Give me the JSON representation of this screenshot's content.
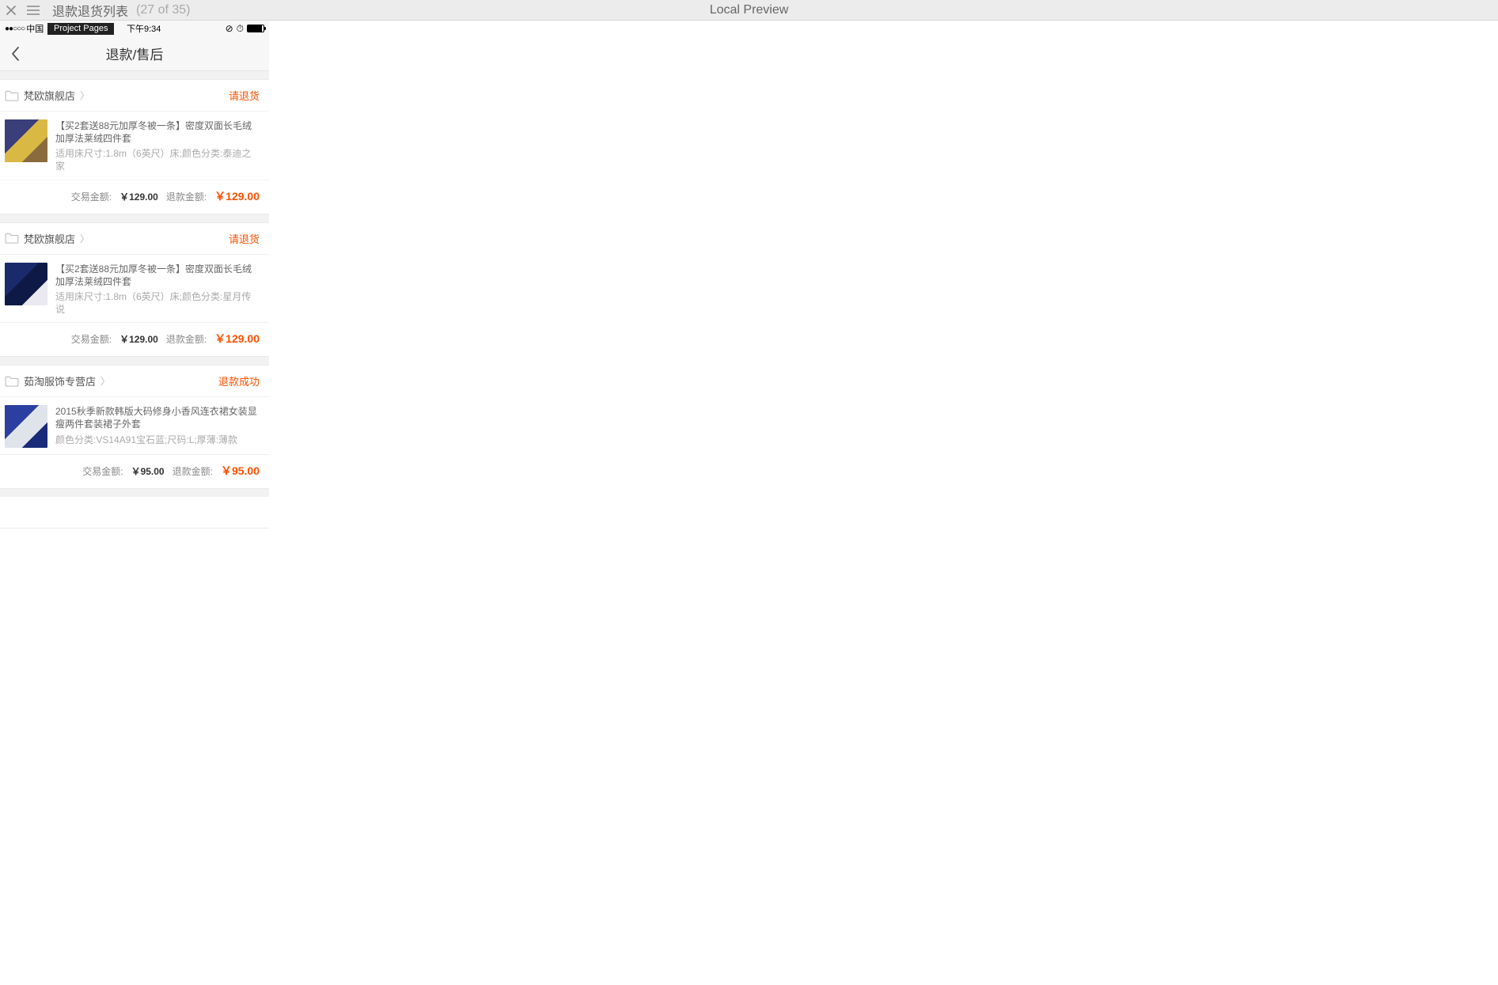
{
  "editor": {
    "title": "退款退货列表",
    "counter": "(27 of 35)",
    "preview": "Local Preview"
  },
  "statusbar": {
    "signal": "●●○○○",
    "carrier": "中国",
    "badge": "Project Pages",
    "time": "下午9:34"
  },
  "nav": {
    "title": "退款/售后"
  },
  "labels": {
    "transaction_amount": "交易金额:",
    "refund_amount": "退款金额:"
  },
  "orders": [
    {
      "store": "梵欧旗舰店",
      "status": "请退货",
      "title": "【买2套送88元加厚冬被一条】密度双面长毛绒加厚法莱绒四件套",
      "spec": "适用床尺寸:1.8m（6英尺）床;颜色分类:泰迪之家",
      "transaction": "￥129.00",
      "refund": "￥129.00",
      "thumb_colors": [
        "#3a3e7a",
        "#d9b844",
        "#8a6b3e"
      ]
    },
    {
      "store": "梵欧旗舰店",
      "status": "请退货",
      "title": "【买2套送88元加厚冬被一条】密度双面长毛绒加厚法莱绒四件套",
      "spec": "适用床尺寸:1.8m（6英尺）床;颜色分类:星月传说",
      "transaction": "￥129.00",
      "refund": "￥129.00",
      "thumb_colors": [
        "#1a2a6b",
        "#0e1a45",
        "#e9e9ef"
      ]
    },
    {
      "store": "茹淘服饰专营店",
      "status": "退款成功",
      "title": "2015秋季新款韩版大码修身小香风连衣裙女装显瘦两件套装裙子外套",
      "spec": "颜色分类:VS14A91宝石蓝;尺码:L;厚薄:薄款",
      "transaction": "￥95.00",
      "refund": "￥95.00",
      "thumb_colors": [
        "#2a3fa0",
        "#dfe3ea",
        "#182a78"
      ]
    }
  ]
}
